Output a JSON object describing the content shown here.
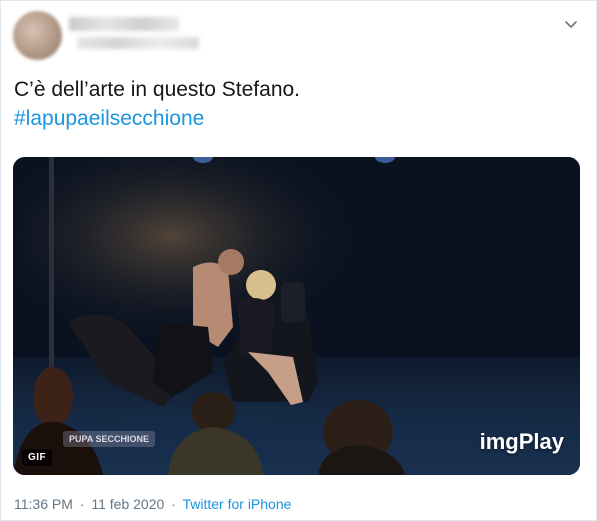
{
  "tweet": {
    "text_line1": "C’è dell’arte in questo Stefano.",
    "hashtag": "#lapupaeilsecchione",
    "media": {
      "badge": "GIF",
      "watermark": "imgPlay",
      "show_logo": "PUPA SECCHIONE"
    },
    "time": "11:36 PM",
    "separator": "·",
    "date": "11 feb 2020",
    "source": "Twitter for iPhone"
  },
  "colors": {
    "link": "#1b95e0",
    "meta": "#657786",
    "text": "#14171a",
    "border": "#e1e8ed"
  },
  "icons": {
    "menu": "chevron-down-icon"
  }
}
